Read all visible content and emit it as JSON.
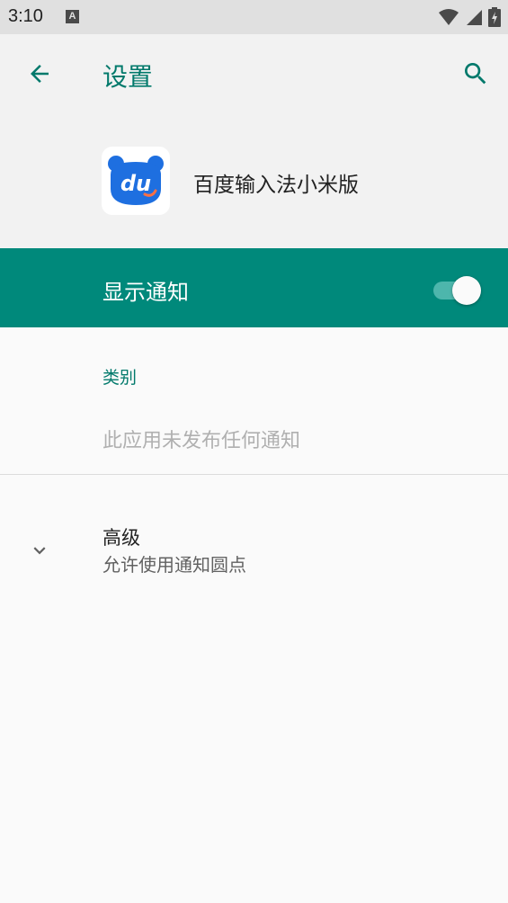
{
  "status_bar": {
    "time": "3:10",
    "notification_icon": "A"
  },
  "app_bar": {
    "title": "设置"
  },
  "app": {
    "name": "百度输入法小米版",
    "icon_text": "du"
  },
  "notifications": {
    "show_label": "显示通知",
    "enabled": true
  },
  "category": {
    "label": "类别",
    "empty_text": "此应用未发布任何通知"
  },
  "advanced": {
    "title": "高级",
    "subtitle": "允许使用通知圆点"
  },
  "colors": {
    "accent": "#00796b",
    "toggle_bg": "#00897b",
    "app_icon_blue": "#1e6fe0"
  }
}
